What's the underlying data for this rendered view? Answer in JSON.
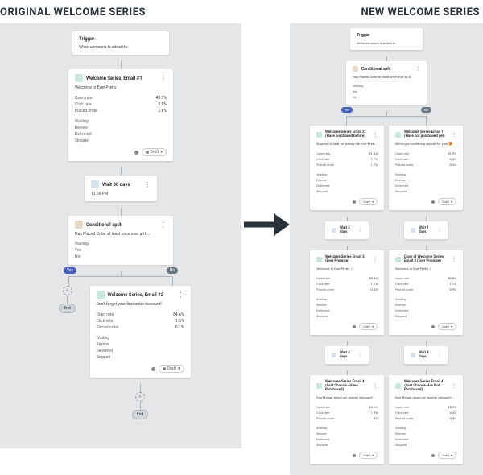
{
  "headings": {
    "original": "ORIGINAL WELCOME SERIES",
    "new": "NEW WELCOME SERIES"
  },
  "branch": {
    "yes": "Yes",
    "no": "No"
  },
  "end": {
    "label": "End"
  },
  "dash_plus": "+",
  "draft_badge": "Draft",
  "menu_dots": "⋮",
  "original": {
    "trigger": {
      "title": "Trigger",
      "subtitle": "When someone is added to"
    },
    "email1": {
      "title": "Welcome Series, Email #1",
      "subtitle": "Welcome to Ever-Pretty",
      "stats": {
        "open": [
          "Open rate",
          "43.3%"
        ],
        "click": [
          "Click rate",
          "5.9%"
        ],
        "placed": [
          "Placed order",
          "2.8%"
        ]
      },
      "status": [
        "Waiting",
        "Review",
        "Delivered",
        "Skipped"
      ]
    },
    "wait": {
      "title": "Wait 30 days",
      "subtitle": "12:00 PM"
    },
    "cond": {
      "title": "Conditional split",
      "subtitle": "Has Placed Order at least once over all ti…",
      "options": [
        "Waiting",
        "Yes",
        "No"
      ]
    },
    "email2": {
      "title": "Welcome Series, Email #2",
      "subtitle": "Don't forget your first order discount!",
      "stats": {
        "open": [
          "Open rate",
          "84.6%"
        ],
        "click": [
          "Click rate",
          "1.5%"
        ],
        "placed": [
          "Placed order",
          "0.1%"
        ]
      },
      "status": [
        "Waiting",
        "Review",
        "Delivered",
        "Skipped"
      ]
    }
  },
  "new": {
    "trigger": {
      "title": "Trigger",
      "subtitle": "When someone is added to"
    },
    "cond": {
      "title": "Conditional split",
      "subtitle": "Has Placed Order at least once over all ti…",
      "options": [
        "Waiting",
        "Yes",
        "No"
      ]
    },
    "yes_col": {
      "e1": {
        "title": "Welcome Series Email 2 (Have purchased before)",
        "subtitle": "Surprise! A treat for joining the Ever-Prett…",
        "stats": {
          "open": [
            "Open rate",
            "51.4%"
          ],
          "click": [
            "Click rate",
            "7.7%"
          ],
          "placed": [
            "Placed order",
            "1.2%"
          ]
        },
        "status": [
          "Waiting",
          "Review",
          "Delivered",
          "Skipped"
        ]
      },
      "w1": {
        "title": "Wait 3 days"
      },
      "e2": {
        "title": "Welcome Series Email 3 (Ever Promise)",
        "subtitle": "Welcome to Ever-Pretty ✓",
        "stats": {
          "open": [
            "Open rate",
            "50.4%"
          ],
          "click": [
            "Click rate",
            "1.2%"
          ],
          "placed": [
            "Placed order",
            "0.3%"
          ]
        },
        "status": [
          "Waiting",
          "Review",
          "Delivered",
          "Skipped"
        ]
      },
      "w2": {
        "title": "Wait 4 days"
      },
      "e3": {
        "title": "Welcome Series Email 4 (Last Chance - Have Purchased)",
        "subtitle": "Don't forget about our special discount! …",
        "stats": {
          "open": [
            "Open rate",
            "40.6%"
          ],
          "click": [
            "Click rate",
            "1.9%"
          ],
          "placed": [
            "Placed order",
            "3%"
          ]
        },
        "status": [
          "Waiting",
          "Review",
          "Delivered",
          "Skipped"
        ]
      }
    },
    "no_col": {
      "e1": {
        "title": "Welcome Series Email 1 (Have not purchased yet)",
        "subtitle": "We've got something special for you! 😍",
        "stats": {
          "open": [
            "Open rate",
            "51.9%"
          ],
          "click": [
            "Click rate",
            "6.3%"
          ],
          "placed": [
            "Placed order",
            "0.2%"
          ]
        },
        "status": [
          "Waiting",
          "Review",
          "Delivered",
          "Skipped"
        ]
      },
      "w1": {
        "title": "Wait 1 days"
      },
      "e2": {
        "title": "Copy of Welcome Series Email 3 (Ever Promise)",
        "subtitle": "Welcome to Ever-Pretty ✓",
        "stats": {
          "open": [
            "Open rate",
            "50.8%"
          ],
          "click": [
            "Click rate",
            "1.1%"
          ],
          "placed": [
            "Placed order",
            "0.9%"
          ]
        },
        "status": [
          "Waiting",
          "Review",
          "Delivered",
          "Skipped"
        ]
      },
      "w2": {
        "title": "Wait 4 days"
      },
      "e3": {
        "title": "Welcome Series Email 4 (Last Chance-Has Not Purchased)",
        "subtitle": "Don't forget about our special discount! …",
        "stats": {
          "open": [
            "Open rate",
            "45.2%"
          ],
          "click": [
            "Click rate",
            "4.4%"
          ],
          "placed": [
            "Placed order",
            "0.4%"
          ]
        },
        "status": [
          "Waiting",
          "Review",
          "Delivered",
          "Skipped"
        ]
      }
    }
  }
}
